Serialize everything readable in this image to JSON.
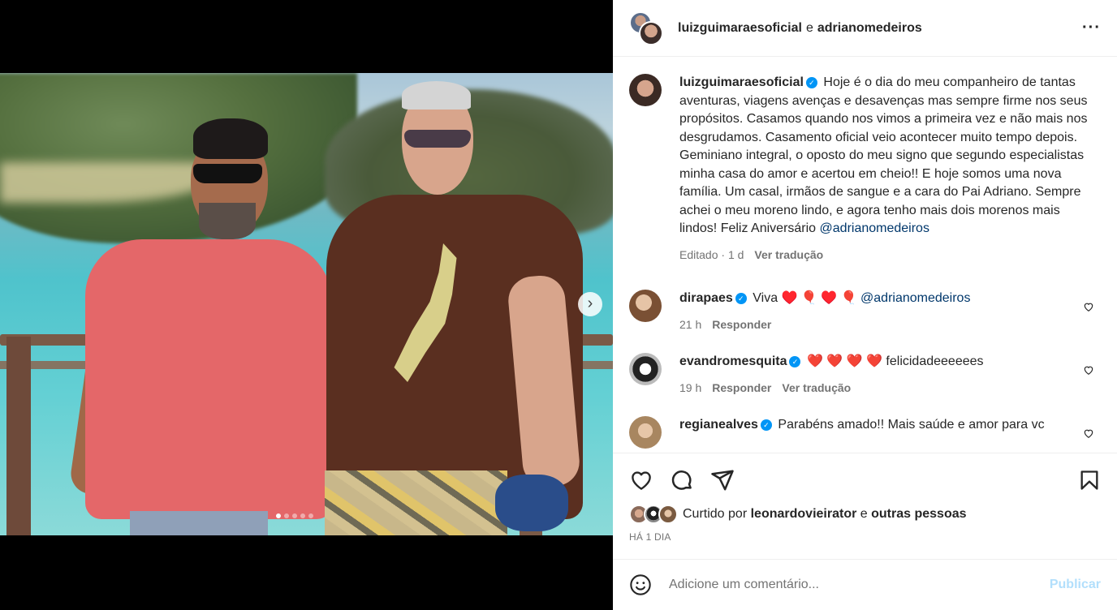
{
  "header": {
    "user1": "luizguimaraesoficial",
    "conjunction": "e",
    "user2": "adrianomedeiros",
    "more_icon": "more-horizontal-icon"
  },
  "caption": {
    "username": "luizguimaraesoficial",
    "text": "Hoje é o dia do meu companheiro de tantas aventuras, viagens avenças e desavenças mas sempre firme nos seus propósitos. Casamos quando nos vimos a primeira vez e não mais nos desgrudamos. Casamento oficial veio acontecer muito tempo depois. Geminiano integral, o oposto do meu signo que segundo especialistas minha casa do amor e acertou em cheio!! E hoje somos uma nova família. Um casal, irmãos de sangue e a cara do Pai Adriano. Sempre achei o meu moreno lindo, e agora tenho mais dois morenos mais lindos! Feliz Aniversário",
    "mention": "@adrianomedeiros",
    "edited": "Editado",
    "time": "1 d",
    "translate": "Ver tradução"
  },
  "comments": [
    {
      "username": "dirapaes",
      "text_prefix": "Viva ♥️ 🎈 ♥️ 🎈",
      "mention": "@adrianomedeiros",
      "time": "21 h",
      "reply": "Responder"
    },
    {
      "username": "evandromesquita",
      "hearts": "❤️ ❤️ ❤️ ❤️",
      "text": "felicidadeeeeees",
      "time": "19 h",
      "reply": "Responder",
      "translate": "Ver tradução"
    },
    {
      "username": "regianealves",
      "text": "Parabéns amado!! Mais saúde e amor para vc"
    }
  ],
  "likes": {
    "prefix": "Curtido por",
    "user": "leonardovieirator",
    "conjunction": "e",
    "others": "outras pessoas"
  },
  "date": "HÁ 1 DIA",
  "add_comment": {
    "placeholder": "Adicione um comentário...",
    "publish": "Publicar"
  },
  "carousel": {
    "total": 5,
    "current": 1,
    "next_icon": "chevron-right-icon"
  }
}
